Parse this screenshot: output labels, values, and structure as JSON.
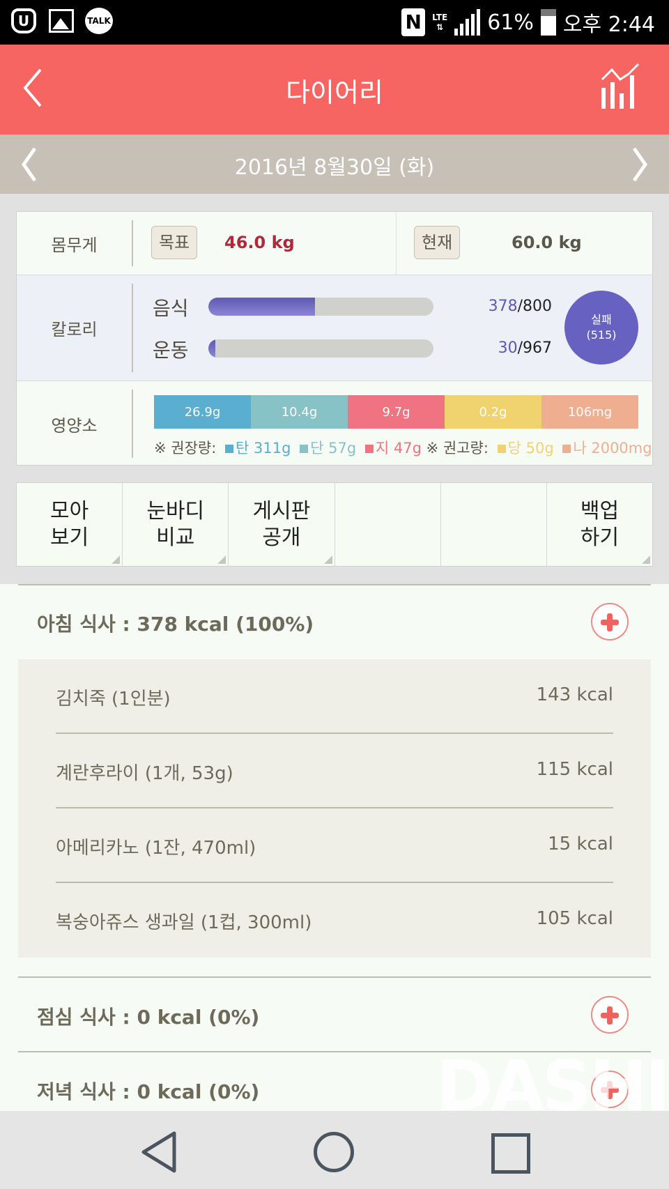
{
  "status_bar": {
    "left_icons": [
      "uplus-icon",
      "gallery-icon",
      "kakaotalk-icon"
    ],
    "talk_label": "TALK",
    "uplus_label": "U",
    "nfc_label": "N",
    "lte_label": "LTE",
    "battery": "61%",
    "time": "오후 2:44"
  },
  "app_bar": {
    "title": "다이어리",
    "back_icon": "chevron-left-icon",
    "stats_icon": "chart-icon"
  },
  "date_bar": {
    "date": "2016년 8월30일 (화)"
  },
  "summary": {
    "weight": {
      "label": "몸무게",
      "goal_tag": "목표",
      "goal_value": "46.0 kg",
      "current_tag": "현재",
      "current_value": "60.0 kg"
    },
    "calorie": {
      "label": "칼로리",
      "food": {
        "label": "음식",
        "current": "378",
        "target": "/800",
        "progress": 0.4725
      },
      "exercise": {
        "label": "운동",
        "current": "30",
        "target": "/967",
        "progress": 0.031
      },
      "status_line1": "실패",
      "status_line2": "(515)"
    },
    "nutrient": {
      "label": "영양소",
      "segments": [
        {
          "value": "26.9g",
          "color": "#5aaecf"
        },
        {
          "value": "10.4g",
          "color": "#87c3c6"
        },
        {
          "value": "9.7g",
          "color": "#ef7381"
        },
        {
          "value": "0.2g",
          "color": "#f0d26e"
        },
        {
          "value": "106mg",
          "color": "#f0ae90"
        }
      ],
      "recommend_label": "※ 권장량:",
      "limit_label": "※ 권고량:",
      "legend": [
        {
          "text": "탄 311g",
          "color": "#5aaecf"
        },
        {
          "text": "단 57g",
          "color": "#87c3c6"
        },
        {
          "text": "지 47g",
          "color": "#ef7381"
        },
        {
          "text": "당 50g",
          "color": "#f0d26e"
        },
        {
          "text": "나 2000mg",
          "color": "#f0ae90"
        }
      ]
    }
  },
  "actions": [
    {
      "line1": "모아",
      "line2": "보기"
    },
    {
      "line1": "눈바디",
      "line2": "비교"
    },
    {
      "line1": "게시판",
      "line2": "공개"
    },
    {
      "line1": "",
      "line2": ""
    },
    {
      "line1": "",
      "line2": ""
    },
    {
      "line1": "백업",
      "line2": "하기"
    }
  ],
  "meals": {
    "breakfast": {
      "title": "아침 식사 : 378 kcal (100%)",
      "items": [
        {
          "name": "김치죽 (1인분)",
          "kcal": "143 kcal"
        },
        {
          "name": "계란후라이 (1개, 53g)",
          "kcal": "115 kcal"
        },
        {
          "name": "아메리카노 (1잔, 470ml)",
          "kcal": "15 kcal"
        },
        {
          "name": "복숭아쥬스 생과일 (1컵, 300ml)",
          "kcal": "105 kcal"
        }
      ]
    },
    "lunch": {
      "title": "점심 식사 : 0 kcal (0%)"
    },
    "dinner": {
      "title": "저녁 식사 : 0 kcal (0%)"
    }
  },
  "watermark": "DASHIN",
  "colors": {
    "accent": "#f76562",
    "date_bar": "#c6c0b7",
    "calorie_fill": "#6762c2",
    "goal_weight": "#b0283a"
  }
}
